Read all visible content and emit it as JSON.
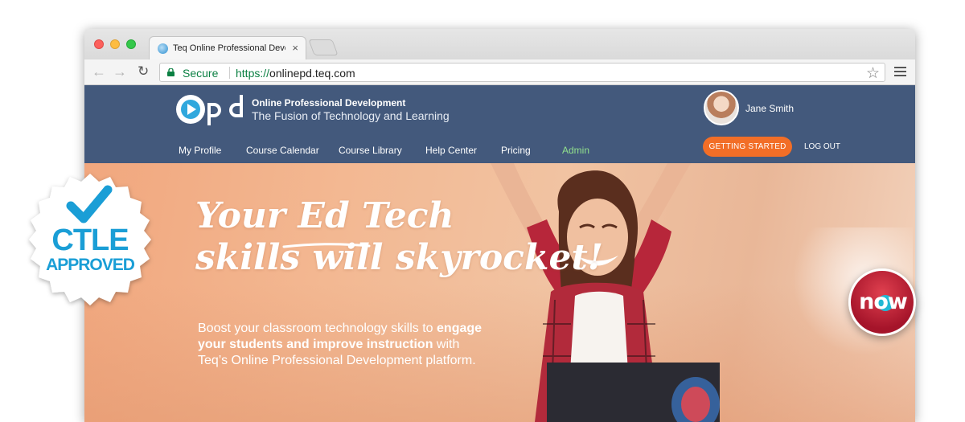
{
  "browser": {
    "tab_title": "Teq Online Professional Develo",
    "tab_close": "×",
    "secure_label": "Secure",
    "url_scheme": "https://",
    "url_host": "onlinepd.teq.com",
    "icons": [
      "back-arrow-icon",
      "forward-arrow-icon",
      "reload-icon",
      "lock-icon",
      "bookmark-star-icon",
      "menu-icon"
    ]
  },
  "header": {
    "tagline_title": "Online Professional Development",
    "tagline_subtitle": "The Fusion of Technology and Learning",
    "user_name": "Jane Smith",
    "cta_label": "GETTING STARTED",
    "logout_label": "LOG OUT",
    "nav": [
      {
        "label": "My Profile"
      },
      {
        "label": "Course Calendar"
      },
      {
        "label": "Course Library"
      },
      {
        "label": "Help Center"
      },
      {
        "label": "Pricing"
      },
      {
        "label": "Admin"
      }
    ]
  },
  "hero": {
    "headline_line1": "Your Ed Tech",
    "headline_line2": "skills will skyrocket!",
    "body_part1": "Boost your classroom technology skills to ",
    "body_bold1": "engage your students and improve instruction",
    "body_part2": " with Teq’s Online Professional Development platform."
  },
  "badges": {
    "ctle_line1": "CTLE",
    "ctle_line2": "APPROVED",
    "now_label": "now"
  },
  "colors": {
    "header_bg": "#3d5478",
    "cta_orange": "#f26a21",
    "admin_green": "#8fe08a",
    "ctle_blue": "#1a9ed6",
    "now_red": "#b5182d"
  }
}
